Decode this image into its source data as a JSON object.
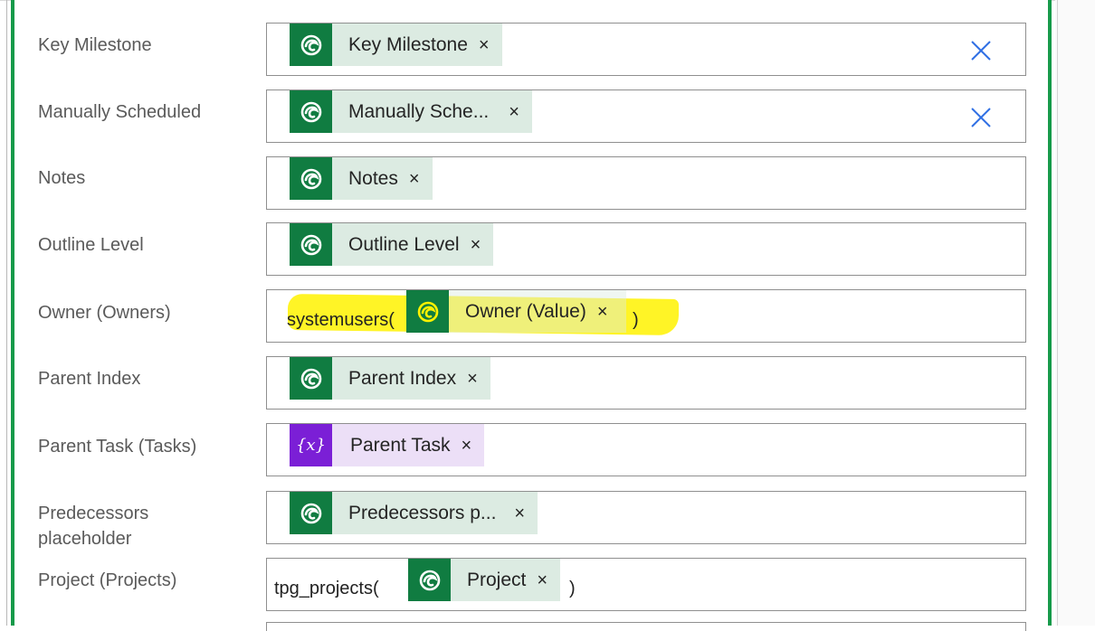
{
  "theme": {
    "accent": "#169a4a",
    "token_green": "#107c41",
    "token_green_bg": "#dcebe2",
    "token_purple": "#7b1fd6",
    "token_purple_bg": "#ecdff7",
    "clear_color": "#2f6fe4",
    "highlight": "#fff200"
  },
  "rows": [
    {
      "label": "Key Milestone",
      "token": "Key Milestone",
      "token_icon": "dataverse-icon",
      "close": "×",
      "has_clear": true
    },
    {
      "label": "Manually Scheduled",
      "token": "Manually Sche...",
      "token_icon": "dataverse-icon",
      "close": "×",
      "has_clear": true
    },
    {
      "label": "Notes",
      "token": "Notes",
      "token_icon": "dataverse-icon",
      "close": "×"
    },
    {
      "label": "Outline Level",
      "token": "Outline Level",
      "token_icon": "dataverse-icon",
      "close": "×"
    },
    {
      "label": "Owner (Owners)",
      "prefix": "systemusers(",
      "token": "Owner (Value)",
      "token_icon": "dataverse-icon",
      "close": "×",
      "suffix": ")"
    },
    {
      "label": "Parent Index",
      "token": "Parent Index",
      "token_icon": "dataverse-icon",
      "close": "×"
    },
    {
      "label": "Parent Task (Tasks)",
      "token": "Parent Task",
      "token_icon": "variable-icon",
      "icon_glyph": "{x}",
      "close": "×"
    },
    {
      "label_line1": "Predecessors",
      "label_line2": "placeholder",
      "token": "Predecessors p...",
      "token_icon": "dataverse-icon",
      "close": "×"
    },
    {
      "label": "Project (Projects)",
      "prefix": "tpg_projects(",
      "token": "Project",
      "token_icon": "dataverse-icon",
      "close": "×",
      "suffix": ")"
    }
  ]
}
